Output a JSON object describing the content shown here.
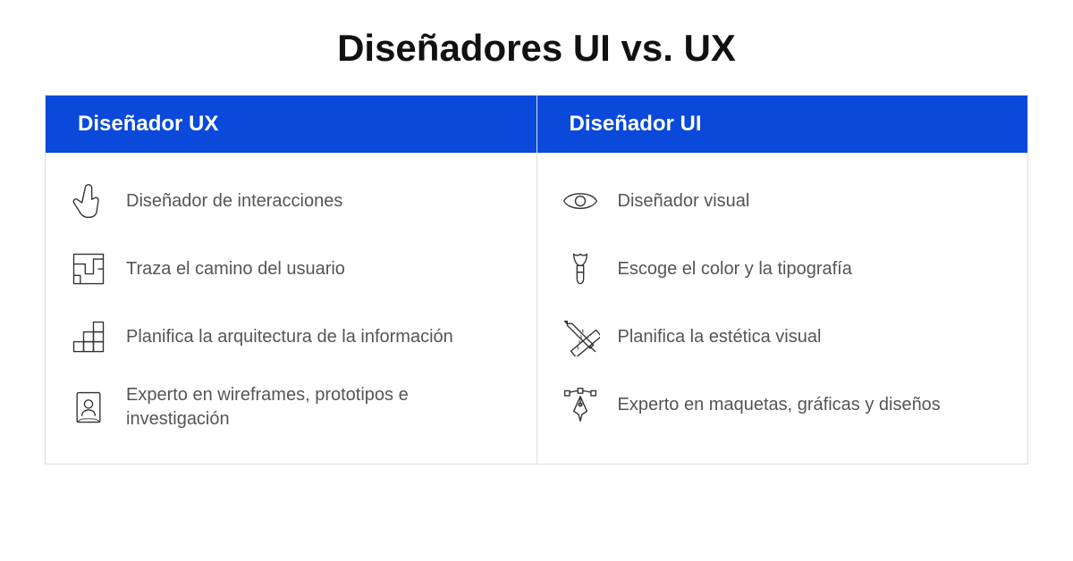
{
  "title": "Diseñadores UI vs. UX",
  "left": {
    "header": "Diseñador UX",
    "items": [
      {
        "icon": "pointer-hand-icon",
        "text": "Diseñador de interacciones"
      },
      {
        "icon": "maze-icon",
        "text": "Traza el camino del usuario"
      },
      {
        "icon": "blocks-icon",
        "text": "Planifica la arquitectura de  la información"
      },
      {
        "icon": "id-document-icon",
        "text": "Experto en wireframes, prototipos e investigación"
      }
    ]
  },
  "right": {
    "header": "Diseñador UI",
    "items": [
      {
        "icon": "eye-icon",
        "text": "Diseñador visual"
      },
      {
        "icon": "brush-icon",
        "text": "Escoge el color y la tipografía"
      },
      {
        "icon": "ruler-pencil-icon",
        "text": "Planifica la estética visual"
      },
      {
        "icon": "vector-pen-icon",
        "text": "Experto en maquetas, gráficas y diseños"
      }
    ]
  },
  "colors": {
    "header_bg": "#0a49d9"
  }
}
